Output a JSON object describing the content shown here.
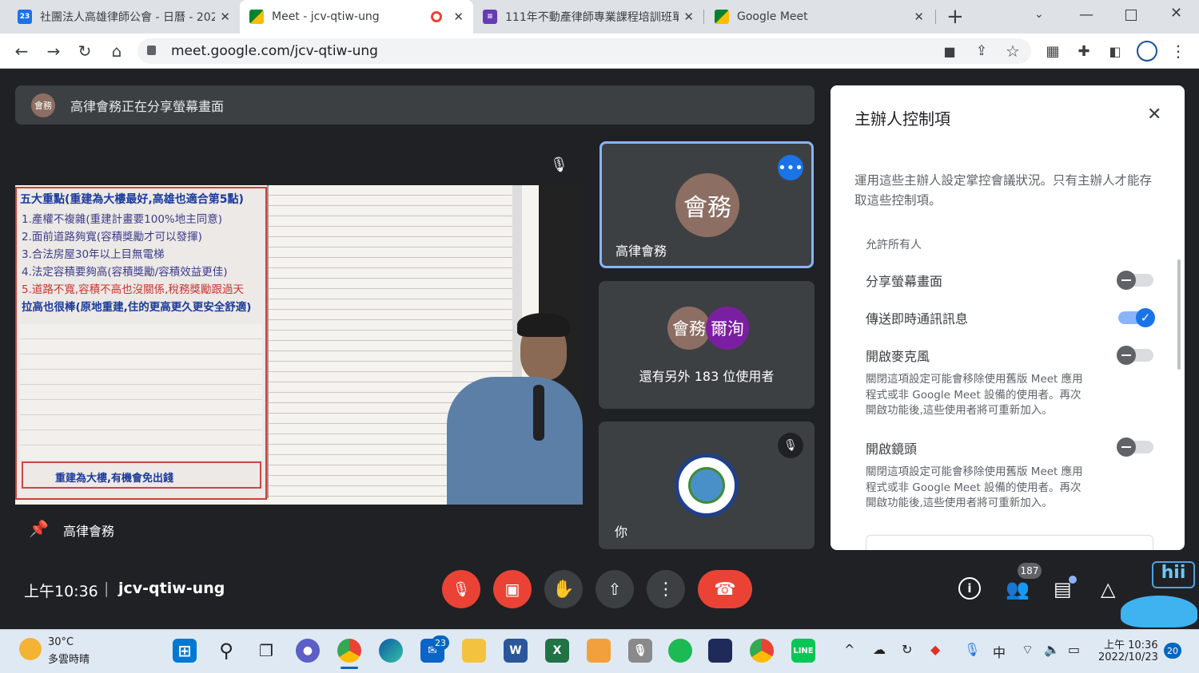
{
  "browser": {
    "tabs": [
      {
        "title": "社團法人高雄律師公會 - 日曆 - 202",
        "favicon": "calendar-icon",
        "favicon_text": "23"
      },
      {
        "title": "Meet - jcv-qtiw-ung",
        "favicon": "meet-icon"
      },
      {
        "title": "111年不動產律師專業課程培訓班單",
        "favicon": "forms-icon"
      },
      {
        "title": "Google Meet",
        "favicon": "meet-icon"
      }
    ],
    "url": "meet.google.com/jcv-qtiw-ung"
  },
  "meet": {
    "banner": {
      "avatar_text": "會務",
      "text": "高律會務正在分享螢幕畫面"
    },
    "main_tile": {
      "name": "高律會務"
    },
    "slide": {
      "title_lines": [
        "五大重點(重建為大樓最好,高雄也適合第5點)"
      ],
      "points": [
        "1.產權不複雜(重建計畫要100%地主同意)",
        "2.面前道路夠寬(容積獎勵才可以發揮)",
        "3.合法房屋30年以上目無電梯",
        "4.法定容積要夠高(容積獎勵/容積效益更佳)",
        "5.道路不寬,容積不高也沒關係,稅務獎勵跟過天",
        "拉高也很棒(原地重建,住的更高更久更安全舒適)"
      ],
      "highlight": "重建為大樓,有機會免出錢"
    },
    "tiles": [
      {
        "avatar_text": "會務",
        "name": "高律會務"
      },
      {
        "avatar1": "會務",
        "avatar2": "爾洵",
        "label": "還有另外 183 位使用者"
      },
      {
        "name": "你"
      }
    ],
    "bottom": {
      "time": "上午10:36",
      "separator": "|",
      "code": "jcv-qtiw-ung",
      "people_count": "187",
      "hii": "hii"
    }
  },
  "host_panel": {
    "title": "主辦人控制項",
    "desc": "運用這些主辦人設定掌控會議狀況。只有主辦人才能存取這些控制項。",
    "section": "允許所有人",
    "items": [
      {
        "label": "分享螢幕畫面",
        "on": false
      },
      {
        "label": "傳送即時通訊訊息",
        "on": true
      },
      {
        "label": "開啟麥克風",
        "on": false,
        "note_lines": [
          "關閉這項設定可能會移除使用舊版 Meet 應用",
          "程式或非 Google Meet 設備的使用者。再次",
          "開啟功能後,這些使用者將可重新加入。"
        ]
      },
      {
        "label": "開啟鏡頭",
        "on": false,
        "note_lines": [
          "關閉這項設定可能會移除使用舊版 Meet 應用",
          "程式或非 Google Meet 設備的使用者。再次",
          "開啟功能後,這些使用者將可重新加入。"
        ]
      }
    ]
  },
  "taskbar": {
    "weather_temp": "30°C",
    "weather_desc": "多雲時晴",
    "mail_badge": "23",
    "ime": "中",
    "time": "上午 10:36",
    "date": "2022/10/23",
    "notif": "20"
  },
  "colors": {
    "meet_bg": "#202124",
    "tile_bg": "#3c4043",
    "accent": "#1a73e8",
    "danger": "#ea4335",
    "active_border": "#8ab4f8"
  }
}
